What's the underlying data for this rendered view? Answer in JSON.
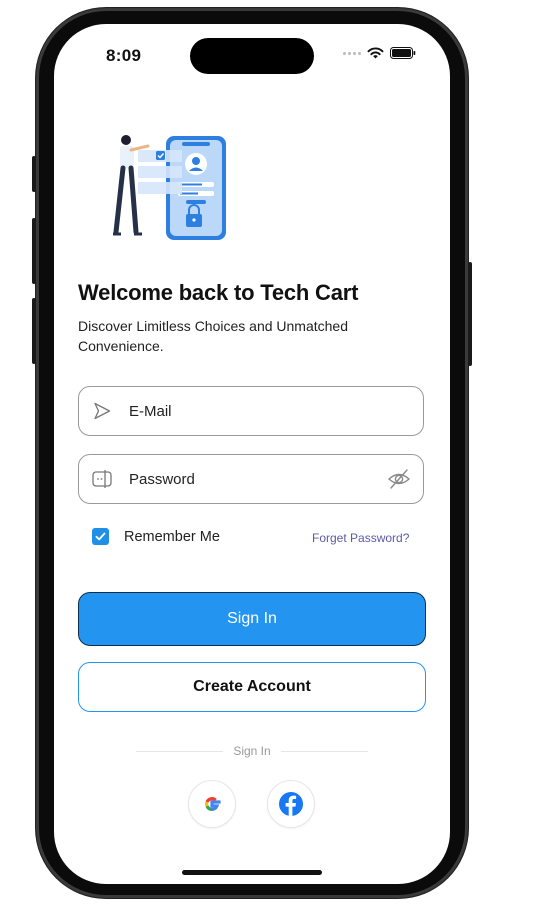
{
  "status_bar": {
    "time": "8:09"
  },
  "header": {
    "title": "Welcome back to Tech Cart",
    "subtitle": "Discover Limitless Choices and Unmatched Convenience."
  },
  "form": {
    "email_placeholder": "E-Mail",
    "email_icon": "direct-right-icon",
    "password_placeholder": "Password",
    "password_icon": "password-check-icon",
    "password_toggle_icon": "eye-slash-icon",
    "remember_label": "Remember Me",
    "remember_checked": true,
    "forget_label": "Forget Password?"
  },
  "actions": {
    "signin_label": "Sign In",
    "create_label": "Create Account"
  },
  "divider_label": "Sign In",
  "social": [
    {
      "name": "google-icon"
    },
    {
      "name": "facebook-icon"
    }
  ],
  "colors": {
    "primary": "#2394F0",
    "link": "#5A5AA8",
    "text": "#111111"
  }
}
